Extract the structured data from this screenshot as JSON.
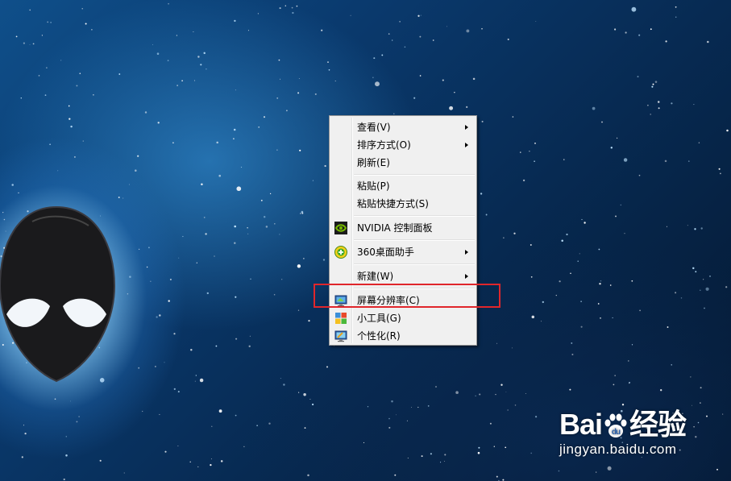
{
  "desktop": {
    "wallpaper": "space-stars-alienware"
  },
  "context_menu": {
    "items": [
      {
        "label": "查看(V)",
        "submenu": true
      },
      {
        "label": "排序方式(O)",
        "submenu": true
      },
      {
        "label": "刷新(E)",
        "submenu": false
      },
      {
        "label": "粘贴(P)",
        "submenu": false
      },
      {
        "label": "粘贴快捷方式(S)",
        "submenu": false
      },
      {
        "label": "NVIDIA 控制面板",
        "submenu": false,
        "icon": "nvidia-icon"
      },
      {
        "label": "360桌面助手",
        "submenu": true,
        "icon": "360-desktop-icon"
      },
      {
        "label": "新建(W)",
        "submenu": true
      },
      {
        "label": "屏幕分辨率(C)",
        "submenu": false,
        "icon": "screen-resolution-icon",
        "highlighted": true
      },
      {
        "label": "小工具(G)",
        "submenu": false,
        "icon": "gadgets-icon"
      },
      {
        "label": "个性化(R)",
        "submenu": false,
        "icon": "personalize-icon"
      }
    ]
  },
  "annotation": {
    "color": "#e0262b"
  },
  "watermark": {
    "brand_left": "Bai",
    "brand_right": "经验",
    "url": "jingyan.baidu.com"
  }
}
